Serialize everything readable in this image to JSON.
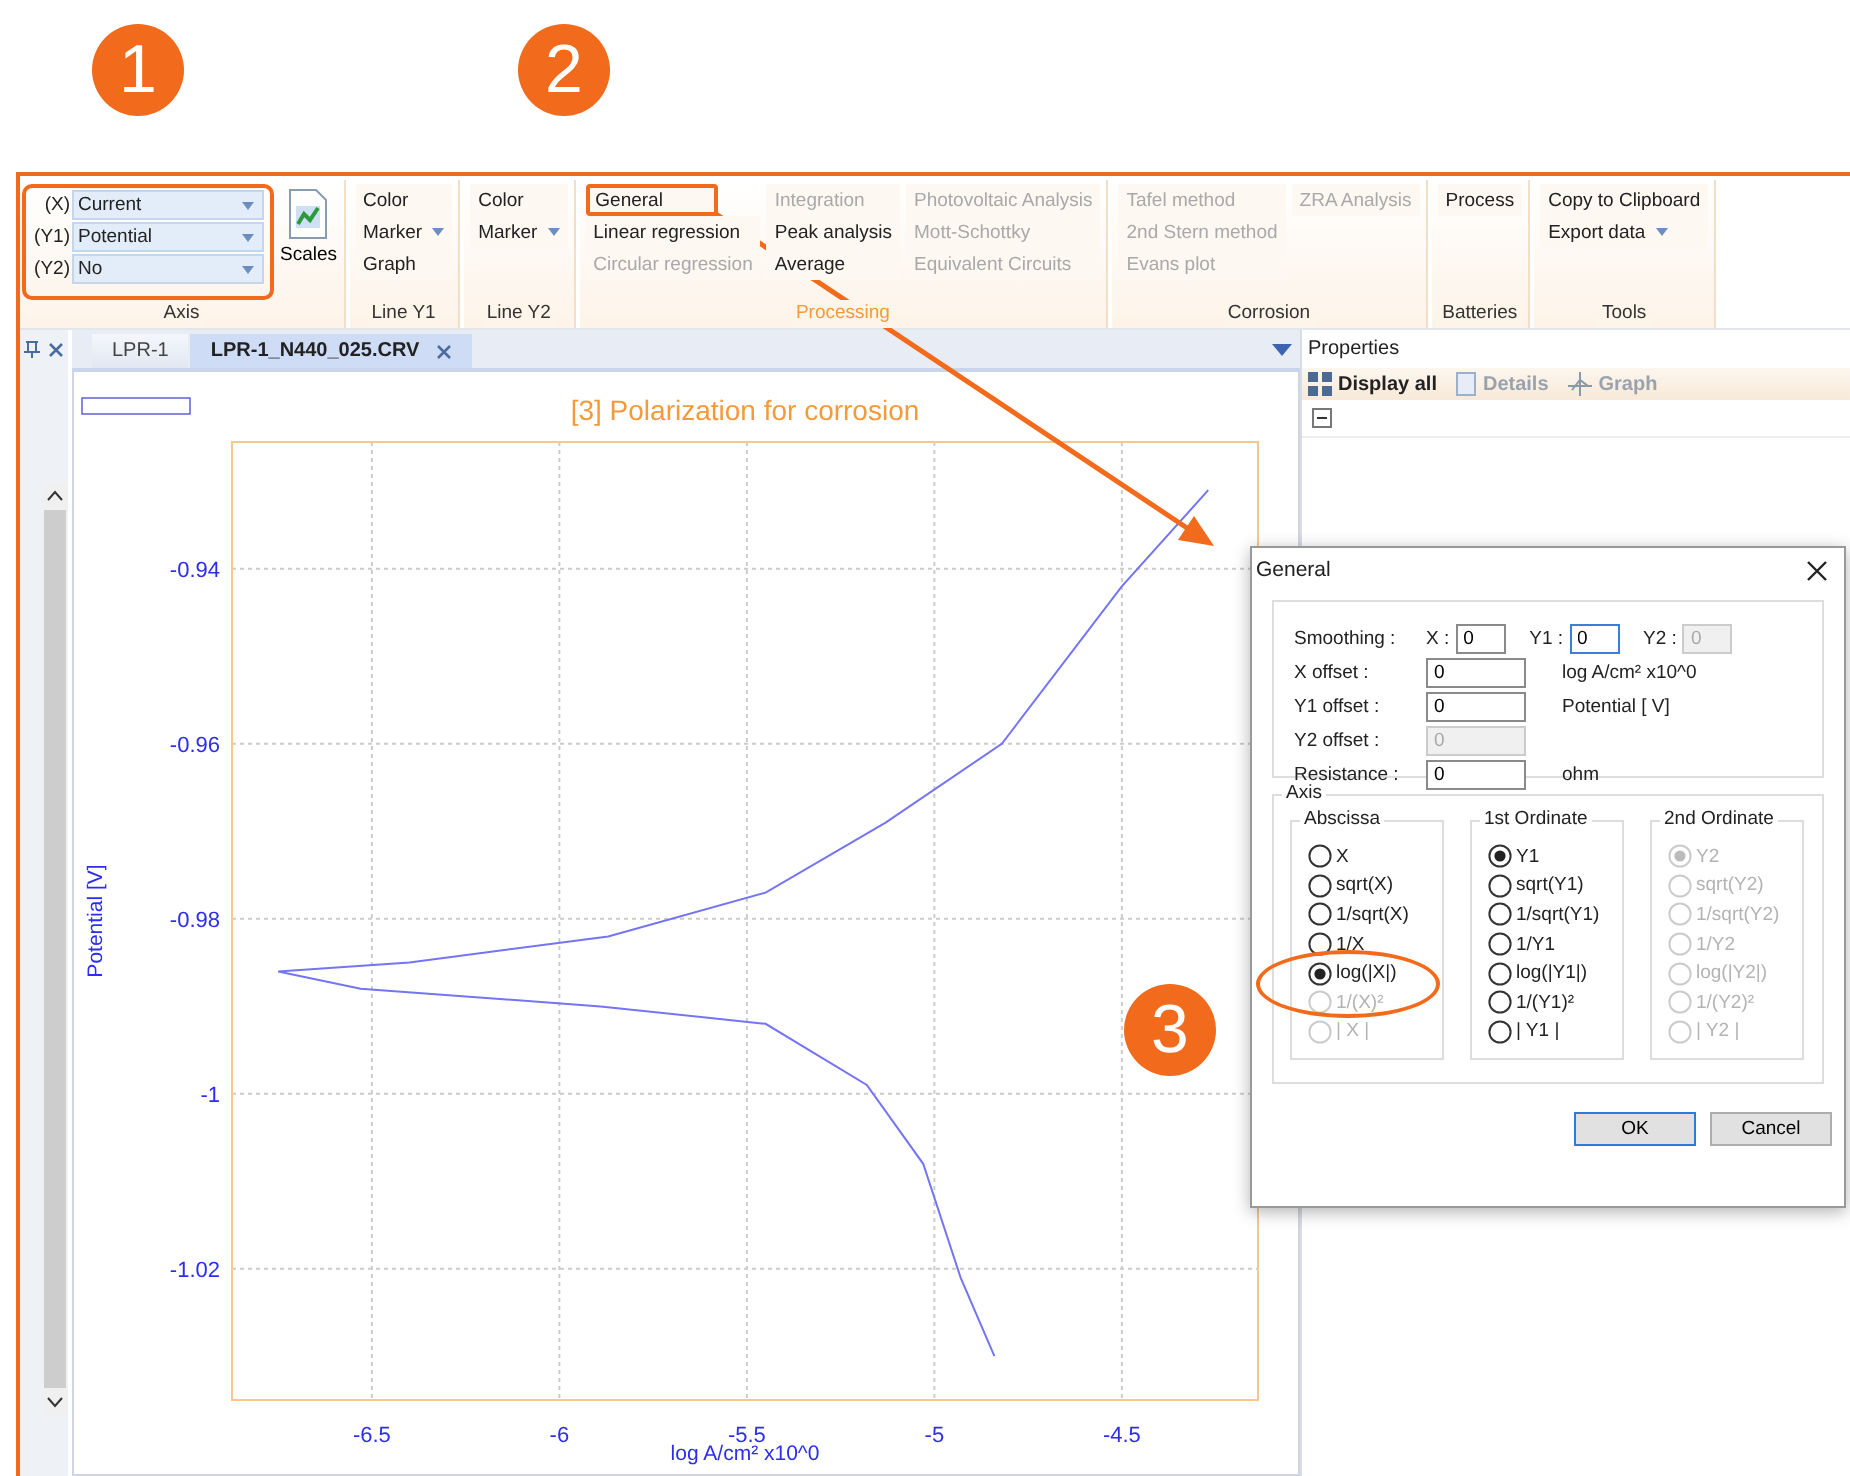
{
  "annotations": [
    {
      "label": "1"
    },
    {
      "label": "2"
    },
    {
      "label": "3"
    }
  ],
  "ribbon": {
    "groups": [
      {
        "title": "Axis",
        "kind": "axis",
        "annotated": true,
        "active": false,
        "combos": [
          {
            "prefix": "(X)",
            "value": "Current"
          },
          {
            "prefix": "(Y1)",
            "value": "Potential"
          },
          {
            "prefix": "(Y2)",
            "value": "No"
          }
        ],
        "button": {
          "label": "Scales"
        }
      },
      {
        "title": "Line Y1",
        "kind": "commands",
        "active": false,
        "columns": [
          [
            {
              "label": "Color",
              "disabled": false,
              "dropdown": false,
              "annotated": false
            },
            {
              "label": "Marker",
              "disabled": false,
              "dropdown": true,
              "annotated": false
            },
            {
              "label": "Graph",
              "disabled": false,
              "dropdown": false,
              "annotated": false
            }
          ]
        ]
      },
      {
        "title": "Line Y2",
        "kind": "commands",
        "active": false,
        "columns": [
          [
            {
              "label": "Color",
              "disabled": false,
              "dropdown": false,
              "annotated": false
            },
            {
              "label": "Marker",
              "disabled": false,
              "dropdown": true,
              "annotated": false
            }
          ]
        ]
      },
      {
        "title": "Processing",
        "kind": "commands",
        "active": true,
        "columns": [
          [
            {
              "label": "General",
              "disabled": false,
              "dropdown": false,
              "annotated": true
            },
            {
              "label": "Linear regression",
              "disabled": false,
              "dropdown": false,
              "annotated": false
            },
            {
              "label": "Circular regression",
              "disabled": true,
              "dropdown": false,
              "annotated": false
            }
          ],
          [
            {
              "label": "Integration",
              "disabled": true,
              "dropdown": false,
              "annotated": false
            },
            {
              "label": "Peak analysis",
              "disabled": false,
              "dropdown": false,
              "annotated": false
            },
            {
              "label": "Average",
              "disabled": false,
              "dropdown": false,
              "annotated": false
            }
          ],
          [
            {
              "label": "Photovoltaic Analysis",
              "disabled": true,
              "dropdown": false,
              "annotated": false
            },
            {
              "label": "Mott-Schottky",
              "disabled": true,
              "dropdown": false,
              "annotated": false
            },
            {
              "label": "Equivalent Circuits",
              "disabled": true,
              "dropdown": false,
              "annotated": false
            }
          ]
        ]
      },
      {
        "title": "Corrosion",
        "kind": "commands",
        "active": false,
        "columns": [
          [
            {
              "label": "Tafel method",
              "disabled": true,
              "dropdown": false,
              "annotated": false
            },
            {
              "label": "2nd Stern method",
              "disabled": true,
              "dropdown": false,
              "annotated": false
            },
            {
              "label": "Evans plot",
              "disabled": true,
              "dropdown": false,
              "annotated": false
            }
          ],
          [
            {
              "label": "ZRA Analysis",
              "disabled": true,
              "dropdown": false,
              "annotated": false
            }
          ]
        ]
      },
      {
        "title": "Batteries",
        "kind": "commands",
        "active": false,
        "columns": [
          [
            {
              "label": "Process",
              "disabled": false,
              "dropdown": false,
              "annotated": false
            }
          ]
        ]
      },
      {
        "title": "Tools",
        "kind": "commands",
        "active": false,
        "columns": [
          [
            {
              "label": "Copy to Clipboard",
              "disabled": false,
              "dropdown": false,
              "annotated": false
            },
            {
              "label": "Export data",
              "disabled": false,
              "dropdown": true,
              "annotated": false
            }
          ]
        ]
      }
    ]
  },
  "tabs": [
    {
      "label": "LPR-1",
      "selected": false
    },
    {
      "label": "LPR-1_N440_025.CRV",
      "selected": true
    }
  ],
  "chart": {
    "chart_data": {
      "type": "line",
      "title": "[3] Polarization for corrosion",
      "xlabel": "log A/cm² x10^0",
      "ylabel": "Potential [V]",
      "x": [
        -4.27,
        -4.5,
        -4.82,
        -5.13,
        -5.45,
        -5.87,
        -6.4,
        -6.75,
        -6.53,
        -5.89,
        -5.45,
        -5.18,
        -5.03,
        -4.93,
        -4.84
      ],
      "grid": true,
      "series": [
        {
          "color": "#7474f4",
          "values": [
            -0.931,
            -0.942,
            -0.96,
            -0.969,
            -0.977,
            -0.982,
            -0.985,
            -0.986,
            -0.988,
            -0.99,
            -0.992,
            -0.999,
            -1.008,
            -1.021,
            -1.03
          ]
        }
      ],
      "xlim": [
        -6.873,
        -4.137
      ],
      "ylim": [
        -1.035,
        -0.9255
      ],
      "xticks": [
        -6.5,
        -6,
        -5.5,
        -5,
        -4.5
      ],
      "yticks": [
        -0.94,
        -0.96,
        -0.98,
        -1,
        -1.02
      ]
    }
  },
  "properties": {
    "title": "Properties",
    "tools": [
      {
        "label": "Display all",
        "kind": "grid",
        "disabled": false
      },
      {
        "label": "Details",
        "kind": "page",
        "disabled": true
      },
      {
        "label": "Graph",
        "kind": "axes",
        "disabled": true
      }
    ]
  },
  "dialog": {
    "title": "General",
    "smoothing": {
      "label": "Smoothing :",
      "fields": [
        {
          "label": "X :",
          "value": "0",
          "disabled": false,
          "focused": false
        },
        {
          "label": "Y1 :",
          "value": "0",
          "disabled": false,
          "focused": true
        },
        {
          "label": "Y2 :",
          "value": "0",
          "disabled": true,
          "focused": false
        }
      ]
    },
    "offsets": [
      {
        "label": "X offset :",
        "value": "0",
        "disabled": false,
        "unit": "log A/cm² x10^0"
      },
      {
        "label": "Y1 offset :",
        "value": "0",
        "disabled": false,
        "unit": "Potential [ V]"
      },
      {
        "label": "Y2 offset :",
        "value": "0",
        "disabled": true
      },
      {
        "label": "Resistance :",
        "value": "0",
        "disabled": false,
        "unit": "ohm"
      }
    ],
    "axis": {
      "title": "Axis",
      "groups": [
        {
          "title": "Abscissa",
          "options": [
            {
              "label": "X",
              "selected": false,
              "disabled": false,
              "annotated": false
            },
            {
              "label": "sqrt(X)",
              "selected": false,
              "disabled": false,
              "annotated": false
            },
            {
              "label": "1/sqrt(X)",
              "selected": false,
              "disabled": false,
              "annotated": false
            },
            {
              "label": "1/X",
              "selected": false,
              "disabled": false,
              "annotated": false
            },
            {
              "label": "log(|X|)",
              "selected": true,
              "disabled": false,
              "annotated": true
            },
            {
              "label": "1/(X)²",
              "selected": false,
              "disabled": true,
              "annotated": false
            },
            {
              "label": "| X |",
              "selected": false,
              "disabled": true,
              "annotated": false
            }
          ]
        },
        {
          "title": "1st Ordinate",
          "options": [
            {
              "label": "Y1",
              "selected": true,
              "disabled": false,
              "annotated": false
            },
            {
              "label": "sqrt(Y1)",
              "selected": false,
              "disabled": false,
              "annotated": false
            },
            {
              "label": "1/sqrt(Y1)",
              "selected": false,
              "disabled": false,
              "annotated": false
            },
            {
              "label": "1/Y1",
              "selected": false,
              "disabled": false,
              "annotated": false
            },
            {
              "label": "log(|Y1|)",
              "selected": false,
              "disabled": false,
              "annotated": false
            },
            {
              "label": "1/(Y1)²",
              "selected": false,
              "disabled": false,
              "annotated": false
            },
            {
              "label": "| Y1 |",
              "selected": false,
              "disabled": false,
              "annotated": false
            }
          ]
        },
        {
          "title": "2nd Ordinate",
          "options": [
            {
              "label": "Y2",
              "selected": true,
              "disabled": true,
              "annotated": false
            },
            {
              "label": "sqrt(Y2)",
              "selected": false,
              "disabled": true,
              "annotated": false
            },
            {
              "label": "1/sqrt(Y2)",
              "selected": false,
              "disabled": true,
              "annotated": false
            },
            {
              "label": "1/Y2",
              "selected": false,
              "disabled": true,
              "annotated": false
            },
            {
              "label": "log(|Y2|)",
              "selected": false,
              "disabled": true,
              "annotated": false
            },
            {
              "label": "1/(Y2)²",
              "selected": false,
              "disabled": true,
              "annotated": false
            },
            {
              "label": "| Y2 |",
              "selected": false,
              "disabled": true,
              "annotated": false
            }
          ]
        }
      ]
    },
    "buttons": [
      {
        "label": "OK",
        "default": true
      },
      {
        "label": "Cancel",
        "default": false
      }
    ]
  }
}
